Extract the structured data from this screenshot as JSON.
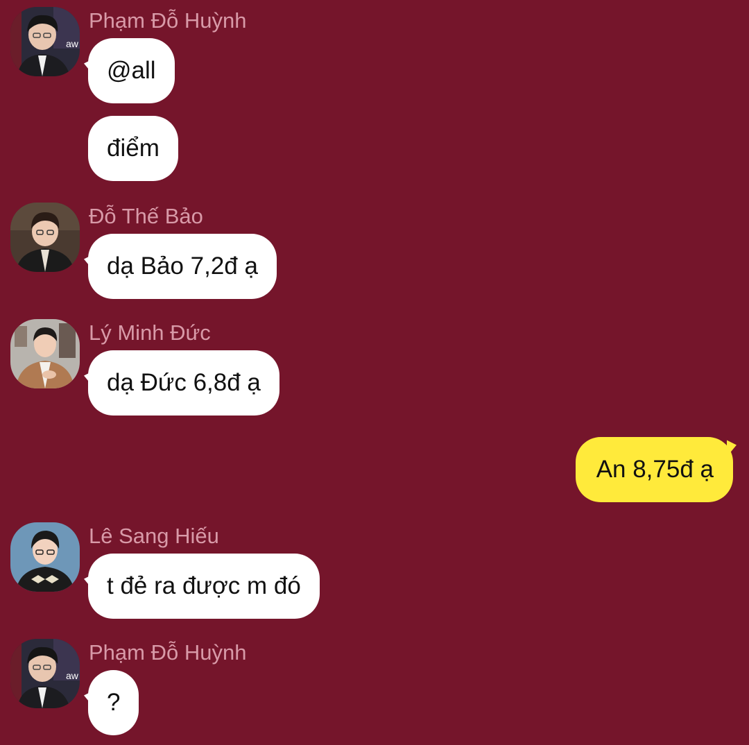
{
  "background_color": "#75152b",
  "outgoing_bubble_color": "#ffea3b",
  "incoming_bubble_color": "#ffffff",
  "messages": [
    {
      "sender": "Phạm Đỗ Huỳnh",
      "text": "@all"
    },
    {
      "text": "điểm"
    },
    {
      "sender": "Đỗ Thế Bảo",
      "text": "dạ Bảo 7,2đ ạ"
    },
    {
      "sender": "Lý Minh Đức",
      "text": "dạ Đức 6,8đ ạ"
    },
    {
      "text": "An 8,75đ ạ"
    },
    {
      "sender": "Lê Sang Hiếu",
      "text": "t đẻ ra được m đó"
    },
    {
      "sender": "Phạm Đỗ Huỳnh",
      "text": "?"
    }
  ]
}
